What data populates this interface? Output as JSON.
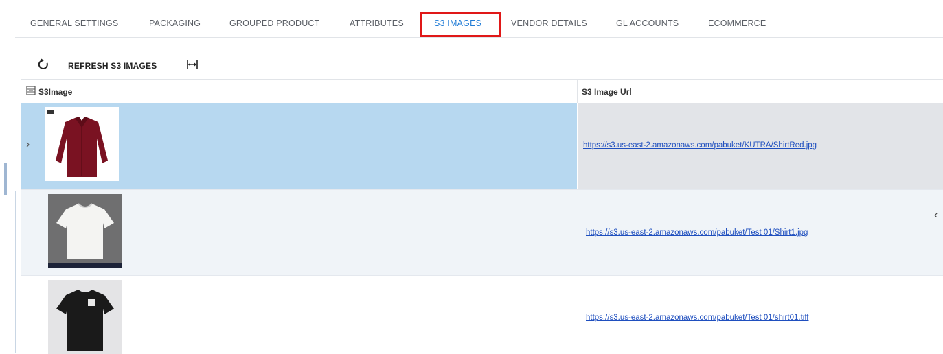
{
  "tabs": [
    {
      "label": "GENERAL SETTINGS"
    },
    {
      "label": "PACKAGING"
    },
    {
      "label": "GROUPED PRODUCT"
    },
    {
      "label": "ATTRIBUTES"
    },
    {
      "label": "S3 IMAGES",
      "active": true
    },
    {
      "label": "VENDOR DETAILS"
    },
    {
      "label": "GL ACCOUNTS"
    },
    {
      "label": "ECOMMERCE"
    }
  ],
  "toolbar": {
    "refresh_icon": "refresh-icon",
    "refresh_label": "REFRESH S3 IMAGES",
    "fit_icon": "fit-columns-icon"
  },
  "grid": {
    "columns": [
      "S3Image",
      "S3 Image Url"
    ],
    "rows": [
      {
        "image": "red shirt",
        "url": "https://s3.us-east-2.amazonaws.com/pabuket/KUTRA/ShirtRed.jpg",
        "selected": true
      },
      {
        "image": "white t-shirt",
        "url": "https://s3.us-east-2.amazonaws.com/pabuket/Test 01/Shirt1.jpg"
      },
      {
        "image": "black t-shirt",
        "url": "https://s3.us-east-2.amazonaws.com/pabuket/Test 01/shirt01.tiff"
      }
    ]
  },
  "colors": {
    "active_tab": "#1f7bd6",
    "highlight_box": "#e01818",
    "selected_row": "#b7d8f0",
    "link": "#1f4fbf"
  }
}
